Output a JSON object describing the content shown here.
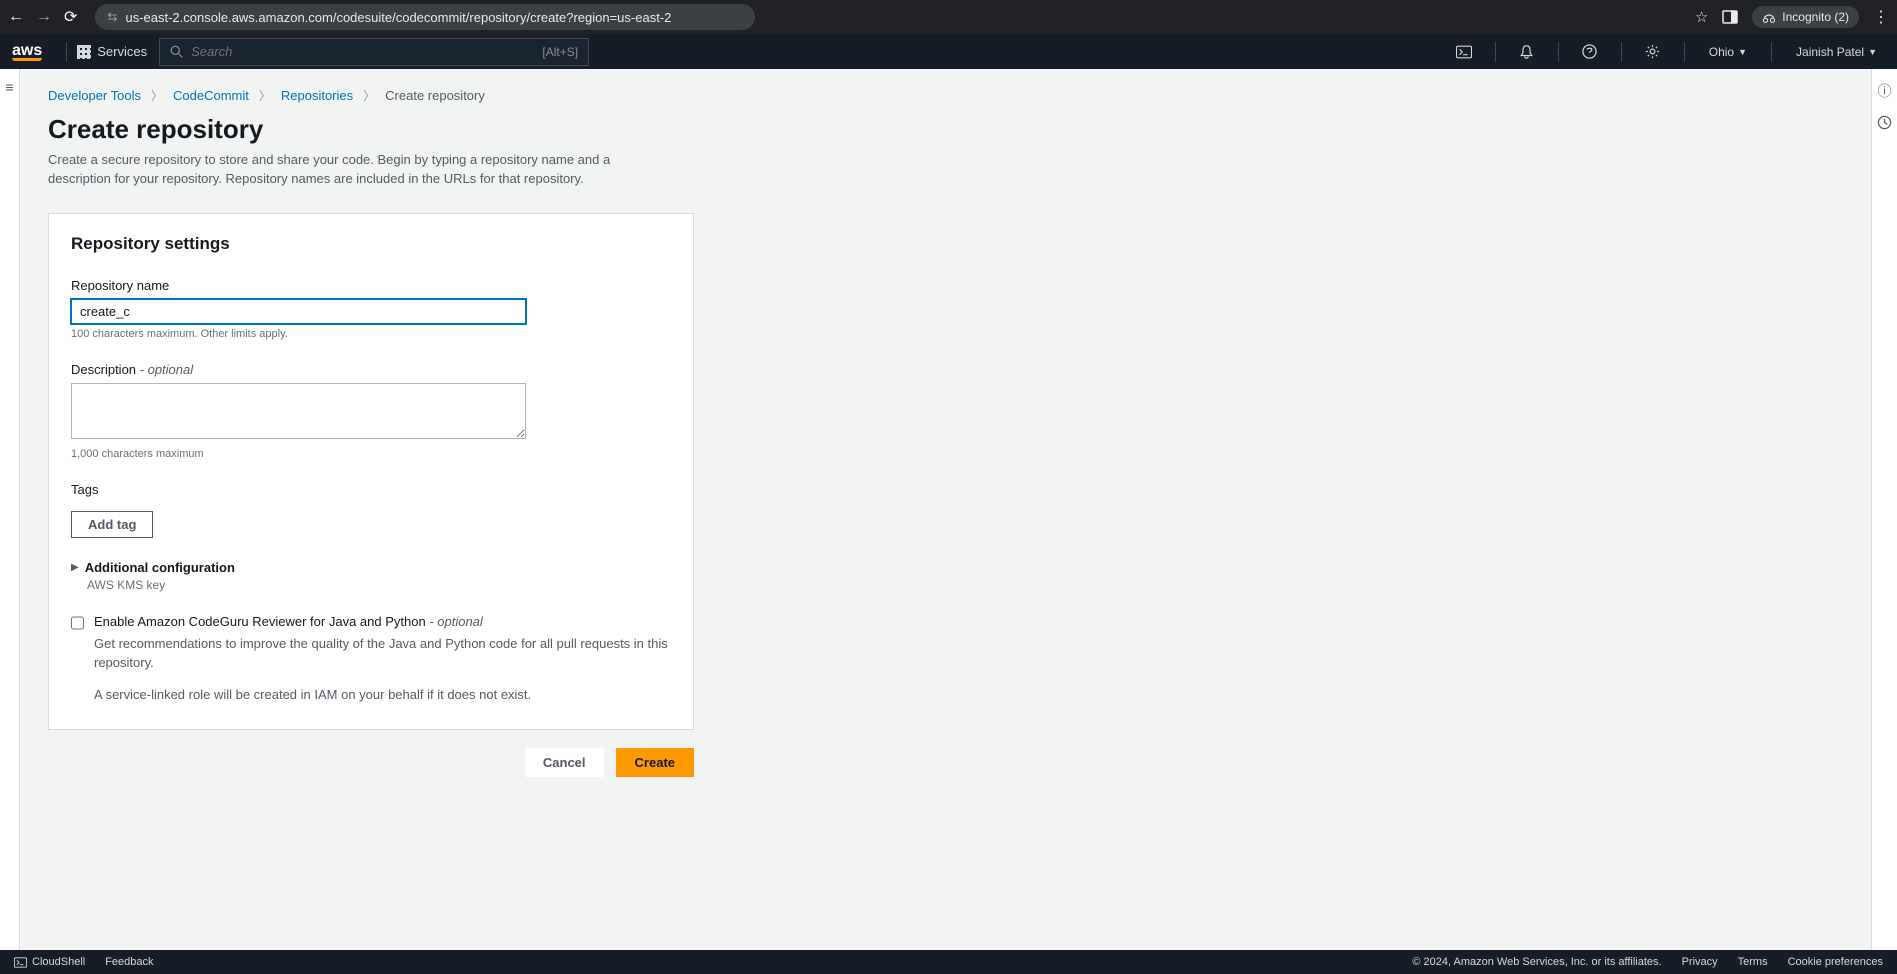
{
  "browser": {
    "url": "us-east-2.console.aws.amazon.com/codesuite/codecommit/repository/create?region=us-east-2",
    "incognito_label": "Incognito (2)"
  },
  "nav": {
    "services": "Services",
    "search_placeholder": "Search",
    "search_hint": "[Alt+S]",
    "region": "Ohio",
    "user": "Jainish Patel"
  },
  "breadcrumbs": {
    "a": "Developer Tools",
    "b": "CodeCommit",
    "c": "Repositories",
    "d": "Create repository"
  },
  "page": {
    "title": "Create repository",
    "description": "Create a secure repository to store and share your code. Begin by typing a repository name and a description for your repository. Repository names are included in the URLs for that repository."
  },
  "form": {
    "settings_header": "Repository settings",
    "repo_name_label": "Repository name",
    "repo_name_value": "create_c",
    "repo_name_hint": "100 characters maximum. Other limits apply.",
    "desc_label": "Description",
    "desc_optional": " - optional",
    "desc_value": "",
    "desc_hint": "1,000 characters maximum",
    "tags_label": "Tags",
    "add_tag_btn": "Add tag",
    "addl_config_label": "Additional configuration",
    "addl_config_sub": "AWS KMS key",
    "codeguru_label": "Enable Amazon CodeGuru Reviewer for Java and Python",
    "codeguru_optional": " - optional",
    "codeguru_desc1": "Get recommendations to improve the quality of the Java and Python code for all pull requests in this repository.",
    "codeguru_desc2": "A service-linked role will be created in IAM on your behalf if it does not exist.",
    "cancel_btn": "Cancel",
    "create_btn": "Create"
  },
  "footer": {
    "cloudshell": "CloudShell",
    "feedback": "Feedback",
    "copyright": "© 2024, Amazon Web Services, Inc. or its affiliates.",
    "privacy": "Privacy",
    "terms": "Terms",
    "cookie": "Cookie preferences"
  }
}
